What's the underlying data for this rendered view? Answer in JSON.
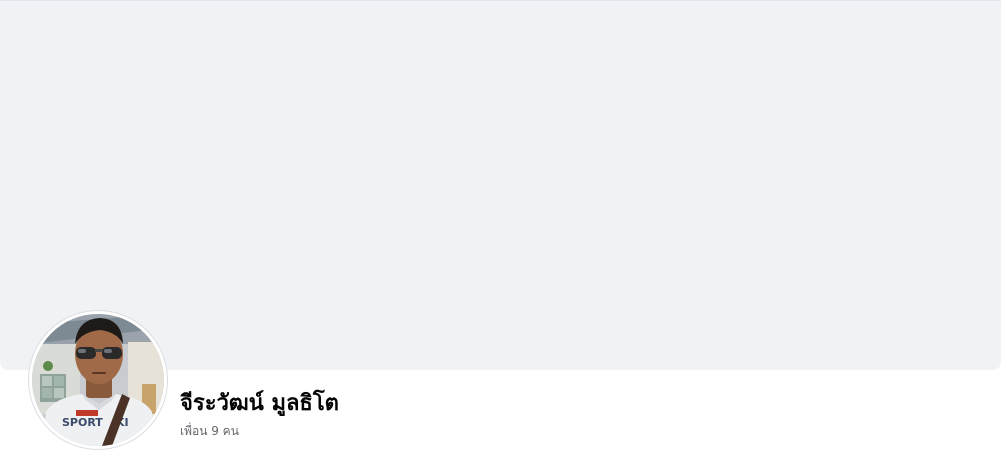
{
  "profile": {
    "name": "จีระวัฒน์ มูลธิโต",
    "friends_count_label": "เพื่อน 9 คน",
    "avatar_icon": "profile-photo-man-sunglasses"
  },
  "colors": {
    "cover_background": "#f0f2f5",
    "page_background": "#ffffff",
    "name_text": "#050505",
    "secondary_text": "#65676b"
  }
}
